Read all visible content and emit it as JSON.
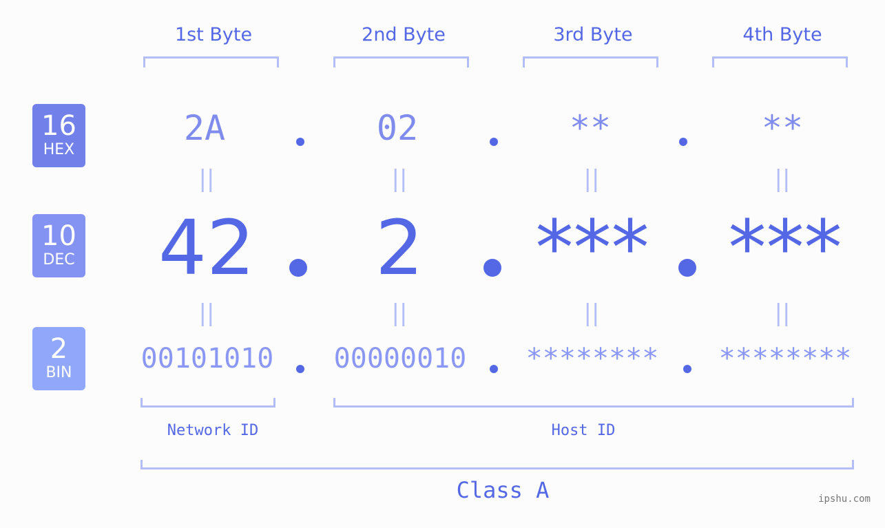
{
  "colors": {
    "hex_badge": "#7281ea",
    "dec_badge": "#8493f2",
    "bin_badge": "#91a8fa",
    "accent": "#5468e6",
    "bracket": "#b3bef8",
    "watermark": "#777777"
  },
  "byte_headers": [
    "1st Byte",
    "2nd Byte",
    "3rd Byte",
    "4th Byte"
  ],
  "badges": {
    "hex": {
      "num": "16",
      "label": "HEX"
    },
    "dec": {
      "num": "10",
      "label": "DEC"
    },
    "bin": {
      "num": "2",
      "label": "BIN"
    }
  },
  "hex_values": [
    "2A",
    "02",
    "**",
    "**"
  ],
  "dec_values": [
    "42",
    "2",
    "***",
    "***"
  ],
  "bin_values": [
    "00101010",
    "00000010",
    "********",
    "********"
  ],
  "equals_glyph": "||",
  "network_id_label": "Network ID",
  "host_id_label": "Host ID",
  "class_label": "Class A",
  "watermark": "ipshu.com"
}
